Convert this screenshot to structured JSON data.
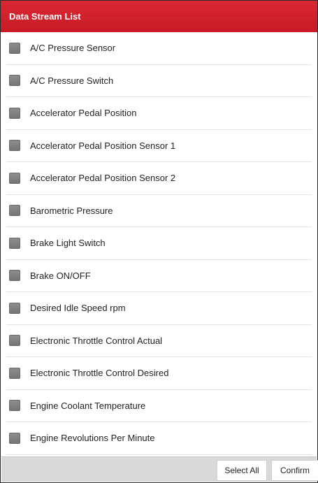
{
  "header": {
    "title": "Data Stream List"
  },
  "items": [
    {
      "label": "A/C Pressure Sensor"
    },
    {
      "label": "A/C Pressure Switch"
    },
    {
      "label": "Accelerator Pedal Position"
    },
    {
      "label": "Accelerator Pedal Position Sensor 1"
    },
    {
      "label": "Accelerator Pedal Position Sensor 2"
    },
    {
      "label": "Barometric Pressure"
    },
    {
      "label": "Brake Light Switch"
    },
    {
      "label": "Brake ON/OFF"
    },
    {
      "label": "Desired Idle Speed rpm"
    },
    {
      "label": "Electronic Throttle Control Actual"
    },
    {
      "label": "Electronic Throttle Control Desired"
    },
    {
      "label": "Engine Coolant Temperature"
    },
    {
      "label": "Engine Revolutions Per Minute"
    }
  ],
  "footer": {
    "select_all_label": "Select All",
    "confirm_label": "Confirm"
  },
  "colors": {
    "header_bg": "#d22530",
    "checkbox": "#7e7e7e",
    "footer_bg": "#d9d9d9"
  }
}
